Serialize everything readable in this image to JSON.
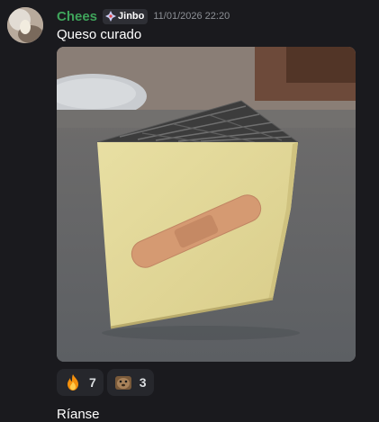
{
  "message": {
    "username": "Chees",
    "tag": "Jinbo",
    "tag_icon": "diamond-sparkle-icon",
    "timestamp": "11/01/2026 22:20",
    "content": "Queso curado",
    "avatar_icon": "cheese-avatar-icon",
    "username_color": "#3fa45b"
  },
  "attachment": {
    "type": "image",
    "description_icon": "cheese-wedge-with-bandage-icon"
  },
  "reactions": [
    {
      "emoji": "fire-icon",
      "count": "7"
    },
    {
      "emoji": "otter-icon",
      "count": "3"
    }
  ],
  "next_message": {
    "content": "Ríanse"
  }
}
